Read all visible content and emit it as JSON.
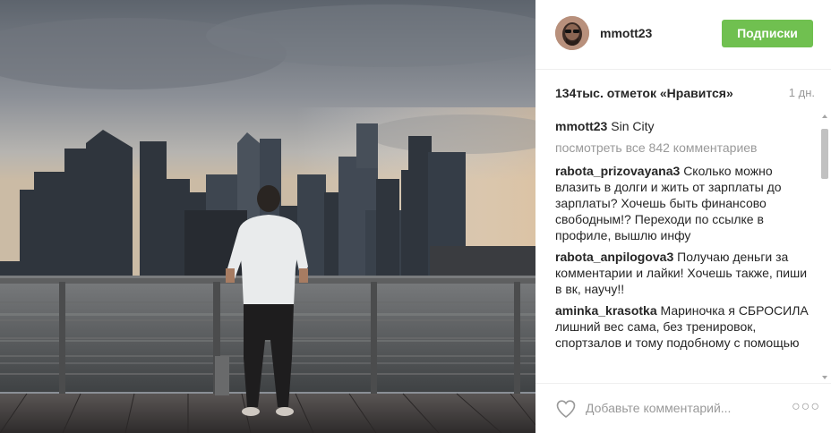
{
  "post": {
    "photo_icon": "photo-image",
    "user": {
      "avatar_icon": "avatar-icon",
      "username": "mmott23",
      "follow_label": "Подписки"
    },
    "likes": "134тыс. отметок «Нравится»",
    "time": "1 дн.",
    "caption": {
      "username": "mmott23",
      "text": "Sin City"
    },
    "view_all_comments": "посмотреть все 842 комментариев",
    "comments": [
      {
        "username": "rabota_prizovayana3",
        "text": "Сколько можно влазить в долги и жить от зарплаты до зарплаты? Хочешь быть финансово свободным!? Переходи по ссылке в профиле, вышлю инфу"
      },
      {
        "username": "rabota_anpilogova3",
        "text": "Получаю деньги за комментарии и лайки! Хочешь также, пиши в вк, научу!!"
      },
      {
        "username": "aminka_krasotka",
        "text": "Мариночка я СБРОСИЛА лишний вес сама, без тренировок, спортзалов и тому подобному с помощью"
      }
    ],
    "footer": {
      "heart_icon": "heart-icon",
      "comment_placeholder": "Добавьте комментарий...",
      "more_icon": "more-icon"
    }
  },
  "colors": {
    "follow_bg": "#70c050",
    "muted": "#999999"
  }
}
